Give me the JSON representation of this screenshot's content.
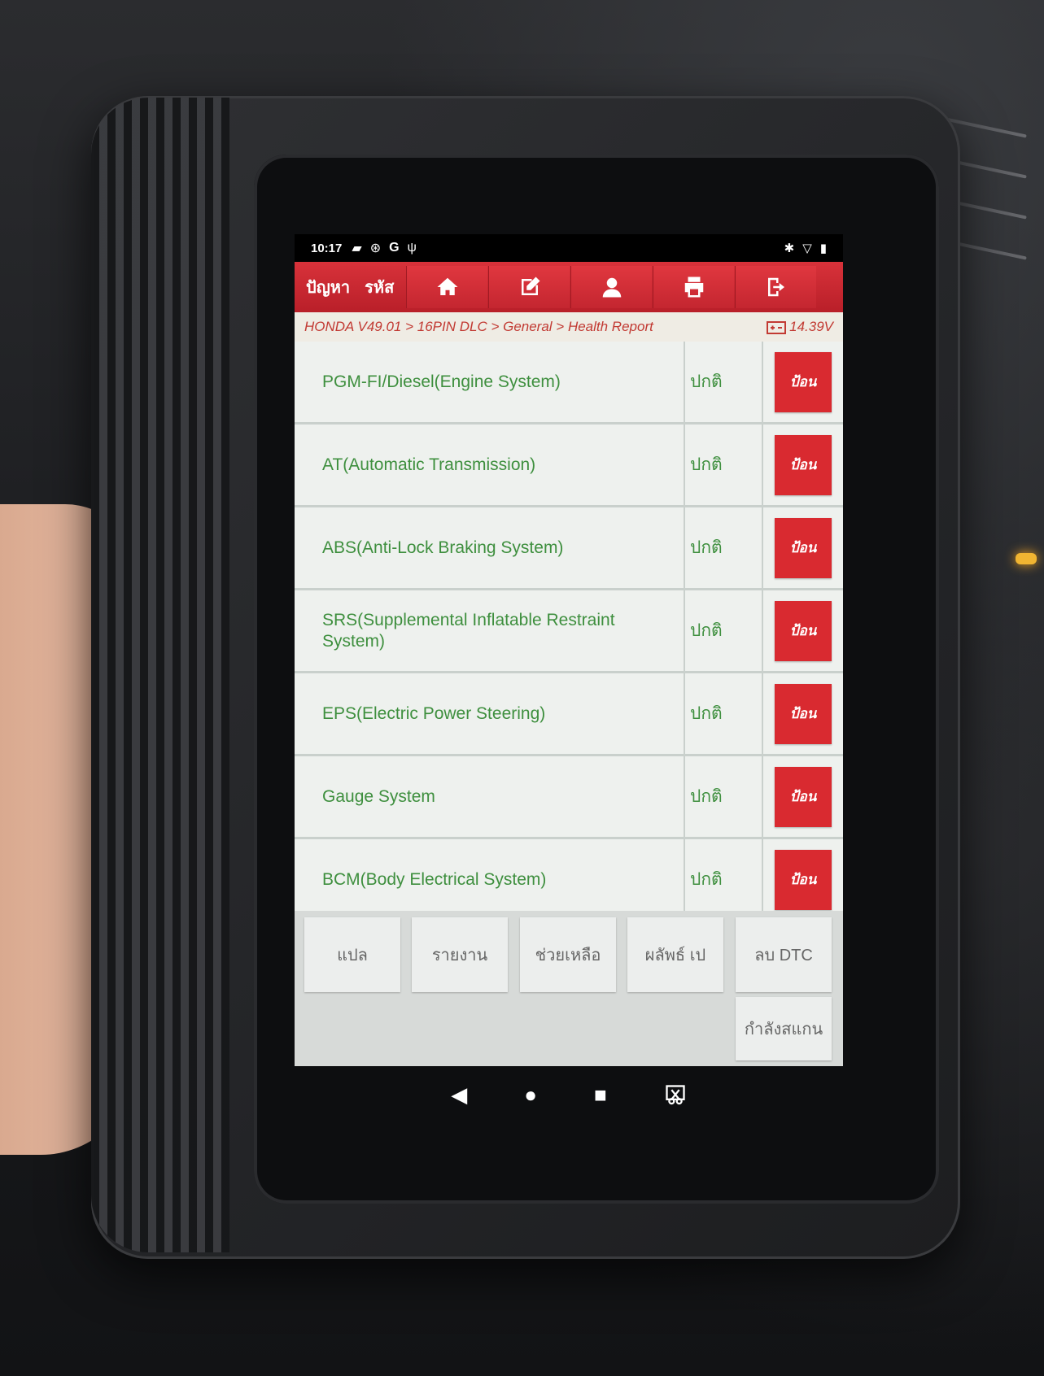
{
  "status_bar": {
    "time": "10:17",
    "icons": [
      "sim-icon",
      "accessibility-icon",
      "google-icon",
      "usb-icon"
    ],
    "right_icons": [
      "bluetooth-icon",
      "wifi-icon",
      "battery-icon"
    ]
  },
  "toolbar": {
    "label_problem": "ปัญหา",
    "label_code": "รหัส",
    "buttons": [
      "home-icon",
      "edit-icon",
      "user-icon",
      "print-icon",
      "exit-icon"
    ]
  },
  "breadcrumb": {
    "path": "HONDA V49.01 > 16PIN DLC > General > Health Report",
    "voltage": "14.39V"
  },
  "systems": [
    {
      "name": "PGM-FI/Diesel(Engine System)",
      "status": "ปกติ",
      "action": "ป้อน"
    },
    {
      "name": "AT(Automatic Transmission)",
      "status": "ปกติ",
      "action": "ป้อน"
    },
    {
      "name": "ABS(Anti-Lock Braking System)",
      "status": "ปกติ",
      "action": "ป้อน"
    },
    {
      "name": "SRS(Supplemental Inflatable Restraint System)",
      "status": "ปกติ",
      "action": "ป้อน"
    },
    {
      "name": "EPS(Electric Power Steering)",
      "status": "ปกติ",
      "action": "ป้อน"
    },
    {
      "name": "Gauge System",
      "status": "ปกติ",
      "action": "ป้อน"
    },
    {
      "name": "BCM(Body Electrical System)",
      "status": "ปกติ",
      "action": "ป้อน"
    }
  ],
  "footer": {
    "translate": "แปล",
    "report": "รายงาน",
    "help": "ช่วยเหลือ",
    "results": "ผลัพธ์ เป",
    "clear_dtc": "ลบ DTC",
    "scanning": "กำลังสแกน"
  },
  "colors": {
    "toolbar_red": "#c42630",
    "text_green": "#3e8f3e",
    "breadcrumb_red": "#c23a33",
    "enter_red": "#d92a30"
  }
}
